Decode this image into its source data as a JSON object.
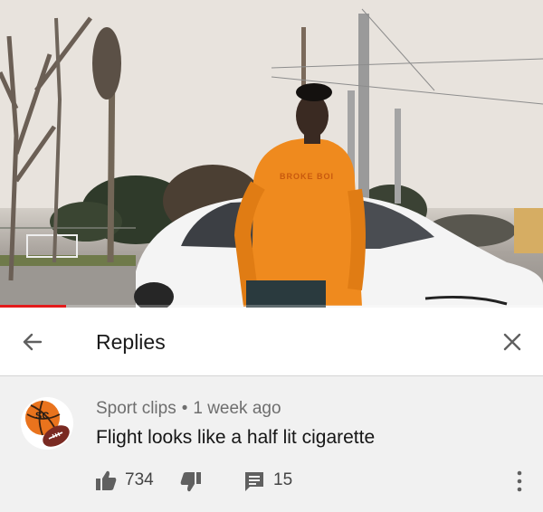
{
  "video": {
    "hoodie_text": "BROKE BOI",
    "progress_fraction": 0.122,
    "accent_color": "#e31b1b"
  },
  "header": {
    "title": "Replies",
    "back_icon": "arrow-left-icon",
    "close_icon": "close-icon"
  },
  "comment": {
    "author": "Sport clips",
    "separator": "•",
    "time": "1 week ago",
    "text": "Flight looks like a half lit cigarette",
    "like_count": "734",
    "reply_count": "15",
    "avatar_icon": "basketball-football-avatar-icon"
  }
}
